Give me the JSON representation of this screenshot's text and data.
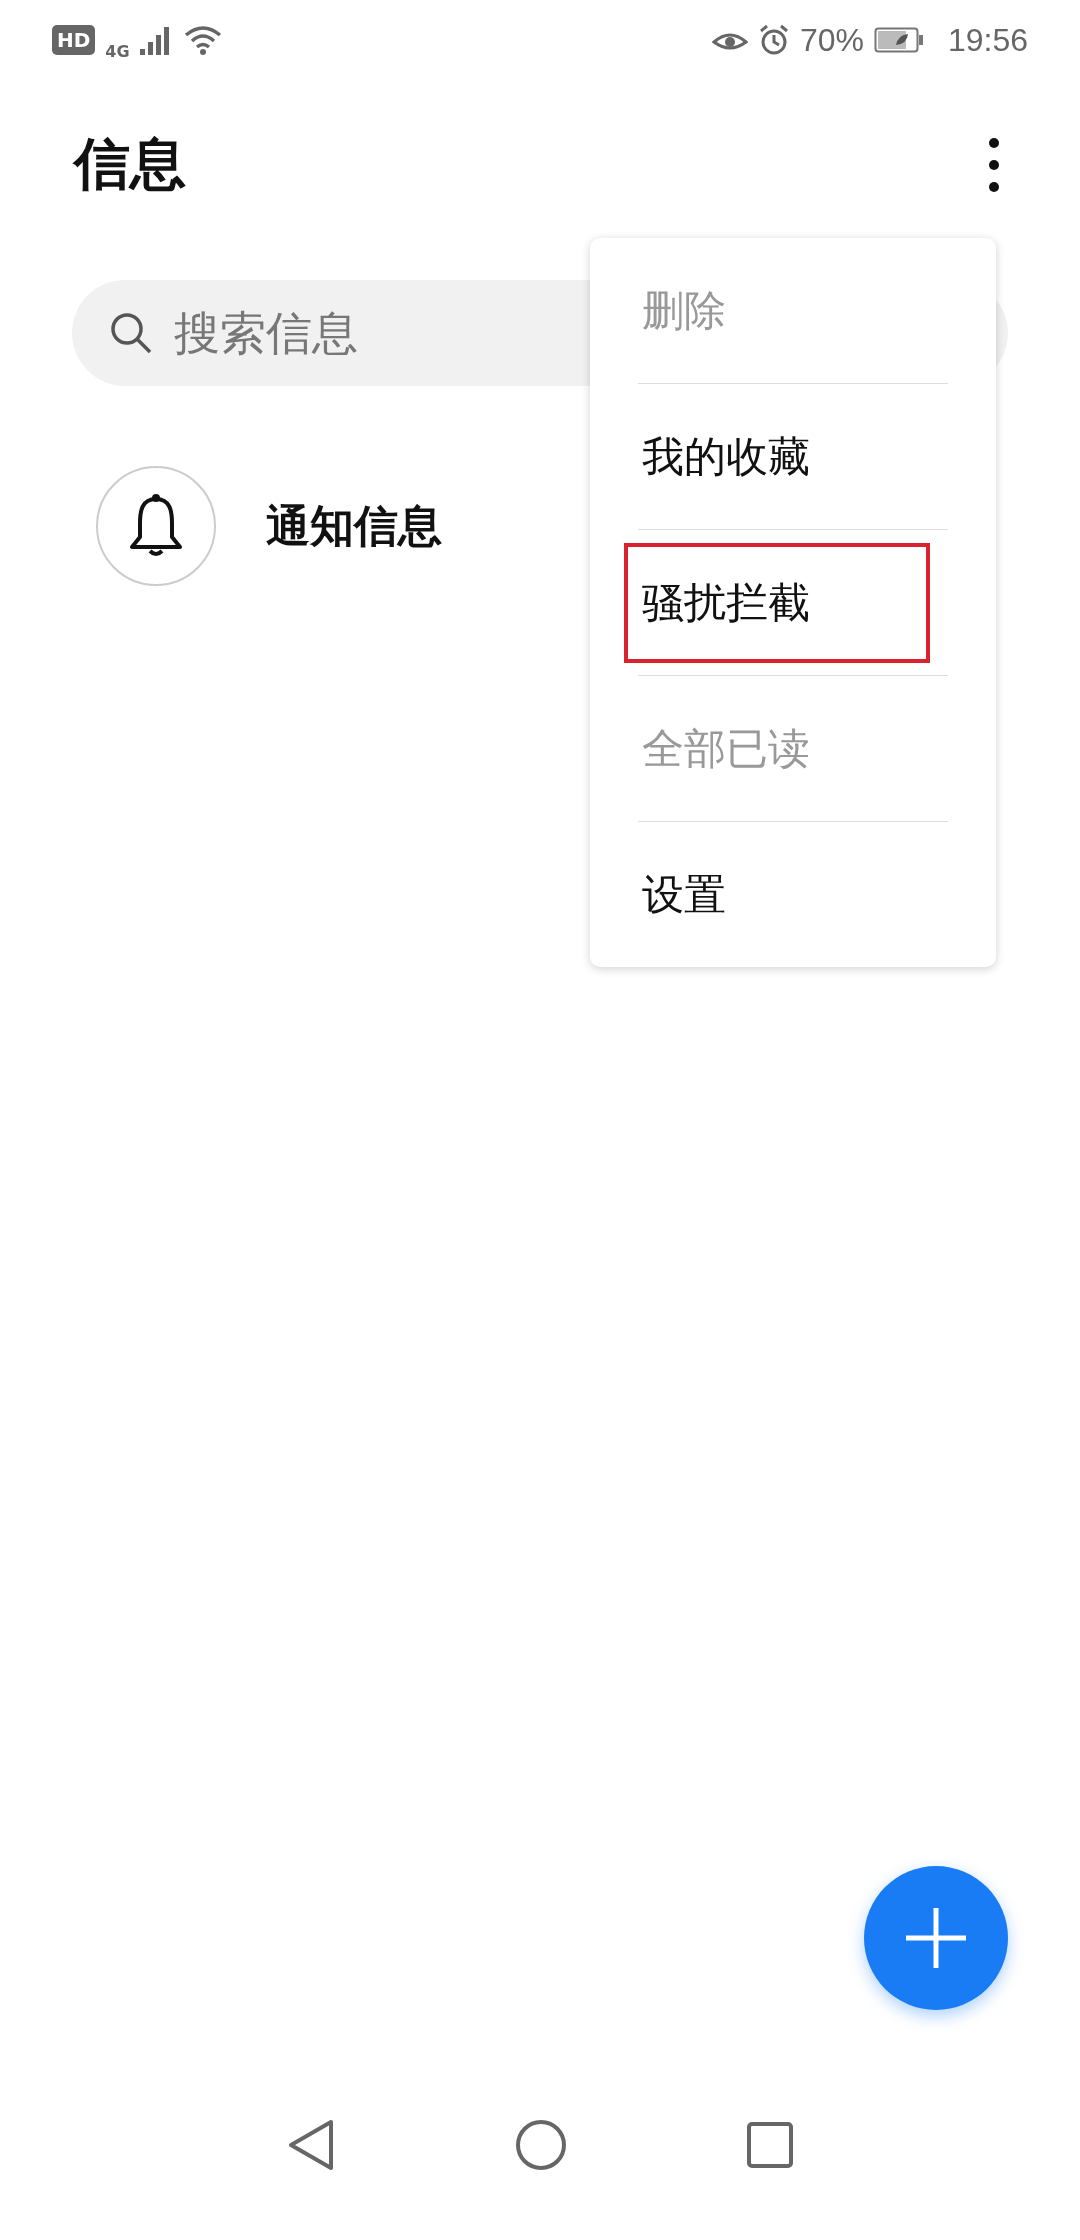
{
  "status_bar": {
    "indicators": [
      "HD",
      "4G"
    ],
    "battery": "70%",
    "time": "19:56"
  },
  "header": {
    "title": "信息"
  },
  "search": {
    "placeholder": "搜索信息"
  },
  "conversations": [
    {
      "name": "通知信息"
    }
  ],
  "menu": [
    {
      "label": "删除",
      "disabled": true,
      "highlighted": false
    },
    {
      "label": "我的收藏",
      "disabled": false,
      "highlighted": false
    },
    {
      "label": "骚扰拦截",
      "disabled": false,
      "highlighted": true
    },
    {
      "label": "全部已读",
      "disabled": true,
      "highlighted": false
    },
    {
      "label": "设置",
      "disabled": false,
      "highlighted": false
    }
  ]
}
